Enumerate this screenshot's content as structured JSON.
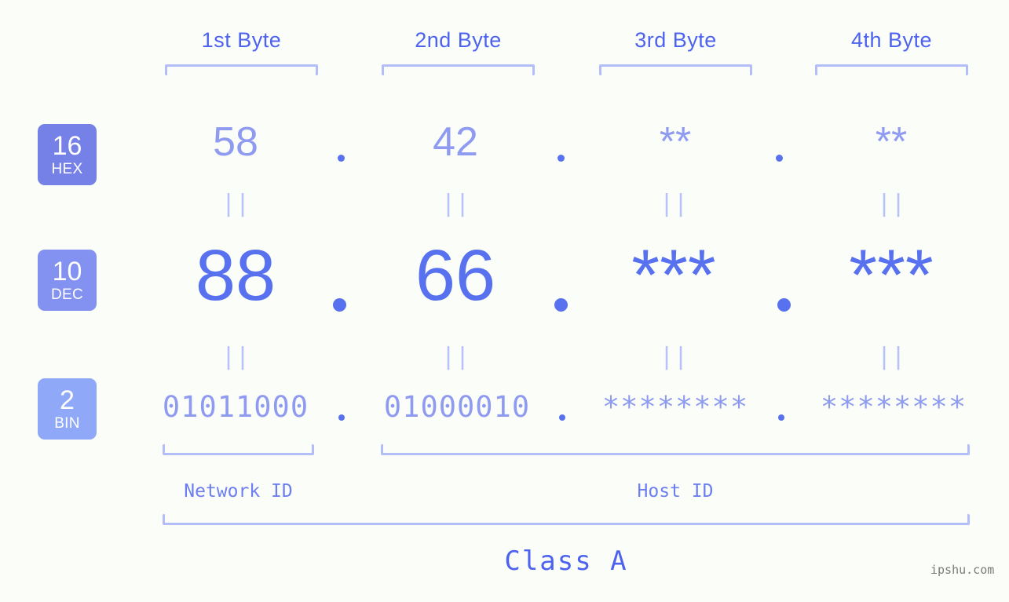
{
  "headers": [
    {
      "label": "1st Byte"
    },
    {
      "label": "2nd Byte"
    },
    {
      "label": "3rd Byte"
    },
    {
      "label": "4th Byte"
    }
  ],
  "rows": [
    {
      "base": "16",
      "name": "HEX",
      "badge_color": "#7681e8",
      "text_color": "#8f9bf0",
      "bytes": [
        "58",
        "42",
        "**",
        "**"
      ],
      "separator": "."
    },
    {
      "base": "10",
      "name": "DEC",
      "badge_color": "#8391f0",
      "text_color": "#5871ef",
      "bytes": [
        "88",
        "66",
        "***",
        "***"
      ],
      "separator": "."
    },
    {
      "base": "2",
      "name": "BIN",
      "badge_color": "#8fa8f7",
      "text_color": "#8f9bf0",
      "bytes": [
        "01011000",
        "01000010",
        "********",
        "********"
      ],
      "separator": "."
    }
  ],
  "equals_mark": "||",
  "segments": {
    "network_id": "Network ID",
    "host_id": "Host ID"
  },
  "class_label": "Class A",
  "watermark": "ipshu.com",
  "colors": {
    "background": "#fbfdf8",
    "accent": "#4d63ef",
    "bracket": "#b3bdf7",
    "muted": "#8f9bf0"
  }
}
